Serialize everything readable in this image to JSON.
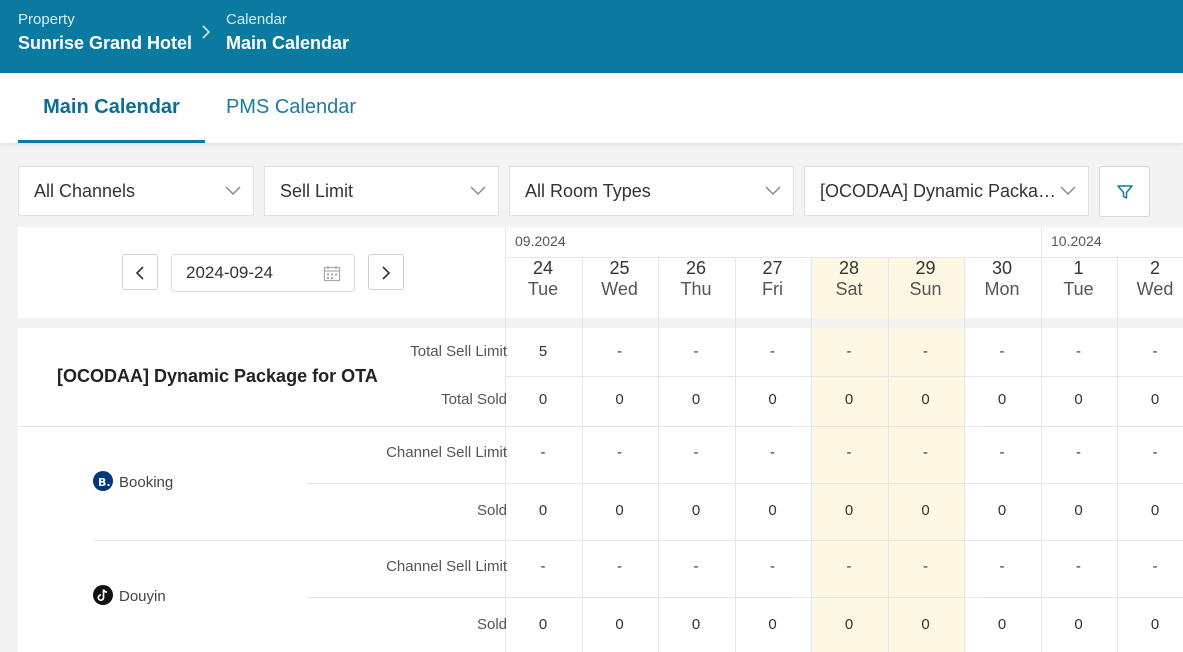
{
  "header": {
    "property_label": "Property",
    "property_value": "Sunrise Grand Hotel",
    "section_label": "Calendar",
    "section_value": "Main Calendar"
  },
  "tabs": [
    {
      "label": "Main Calendar",
      "active": true
    },
    {
      "label": "PMS Calendar",
      "active": false
    }
  ],
  "filters": {
    "channels": "All Channels",
    "metric": "Sell Limit",
    "room_types": "All Room Types",
    "package": "[OCODAA] Dynamic Packa…"
  },
  "date_picker": {
    "value": "2024-09-24"
  },
  "months": [
    "09.2024",
    "10.2024"
  ],
  "days": [
    {
      "num": "24",
      "name": "Tue",
      "weekend": false
    },
    {
      "num": "25",
      "name": "Wed",
      "weekend": false
    },
    {
      "num": "26",
      "name": "Thu",
      "weekend": false
    },
    {
      "num": "27",
      "name": "Fri",
      "weekend": false
    },
    {
      "num": "28",
      "name": "Sat",
      "weekend": true
    },
    {
      "num": "29",
      "name": "Sun",
      "weekend": true
    },
    {
      "num": "30",
      "name": "Mon",
      "weekend": false
    },
    {
      "num": "1",
      "name": "Tue",
      "weekend": false
    },
    {
      "num": "2",
      "name": "Wed",
      "weekend": false
    }
  ],
  "package": {
    "title": "[OCODAA] Dynamic Package for OTA",
    "rows": [
      {
        "label": "Total Sell Limit",
        "values": [
          "5",
          "-",
          "-",
          "-",
          "-",
          "-",
          "-",
          "-",
          "-"
        ]
      },
      {
        "label": "Total Sold",
        "values": [
          "0",
          "0",
          "0",
          "0",
          "0",
          "0",
          "0",
          "0",
          "0"
        ]
      }
    ]
  },
  "channels": [
    {
      "name": "Booking",
      "logo_icon": "booking-logo-icon",
      "logo_color": "#003580",
      "rows": [
        {
          "label": "Channel Sell Limit",
          "values": [
            "-",
            "-",
            "-",
            "-",
            "-",
            "-",
            "-",
            "-",
            "-"
          ]
        },
        {
          "label": "Sold",
          "values": [
            "0",
            "0",
            "0",
            "0",
            "0",
            "0",
            "0",
            "0",
            "0"
          ]
        }
      ]
    },
    {
      "name": "Douyin",
      "logo_icon": "douyin-logo-icon",
      "logo_color": "#111111",
      "rows": [
        {
          "label": "Channel Sell Limit",
          "values": [
            "-",
            "-",
            "-",
            "-",
            "-",
            "-",
            "-",
            "-",
            "-"
          ]
        },
        {
          "label": "Sold",
          "values": [
            "0",
            "0",
            "0",
            "0",
            "0",
            "0",
            "0",
            "0",
            "0"
          ]
        }
      ]
    }
  ],
  "colors": {
    "header_bg": "#0b7aa1",
    "weekend_bg": "#fdf7e3",
    "tab_active": "#0b6e92"
  }
}
